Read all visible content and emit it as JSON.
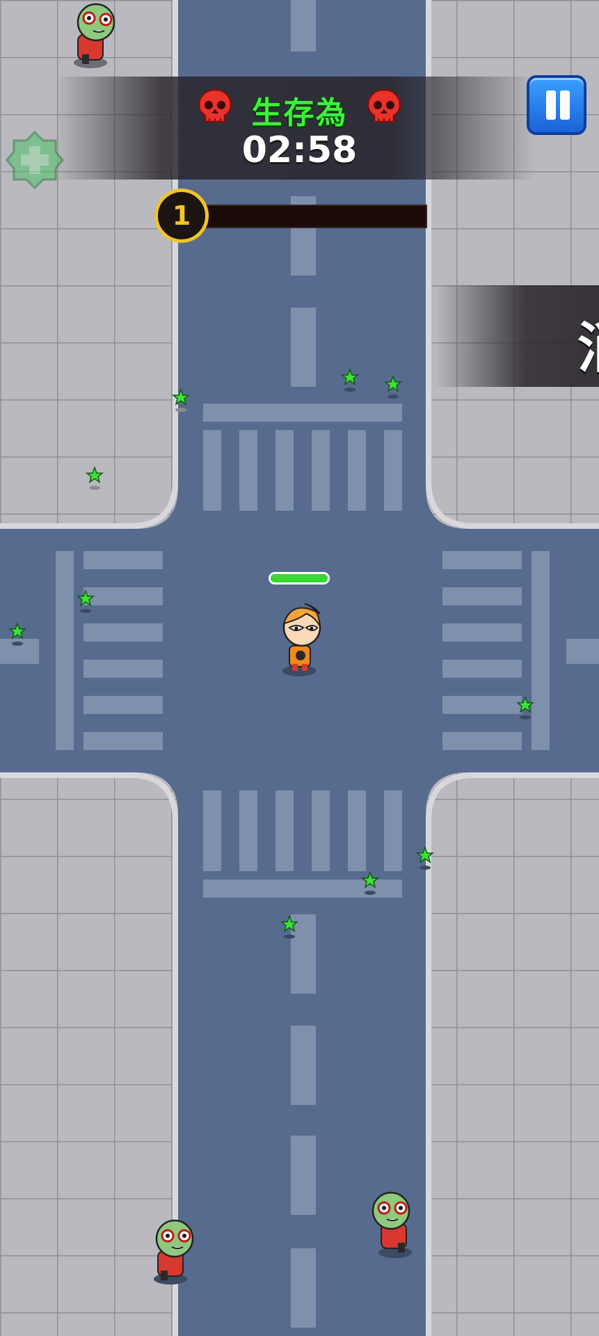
{
  "hud": {
    "mode_label": "生存為",
    "timer": "02:58",
    "level": "1",
    "level_progress": 0.0,
    "side_banner_text": "消"
  },
  "player": {
    "health": 1.0
  },
  "icons": {
    "skull": "skull-icon",
    "pause": "pause-icon",
    "heal": "heal-plus-icon",
    "star": "xp-star-icon"
  },
  "colors": {
    "title_green": "#3ef03c",
    "road": "#566b8e",
    "sidewalk": "#b9b9bf",
    "level_gold": "#f2c428",
    "health_green": "#39d834",
    "pause_blue": "#2a82ee",
    "skull_red": "#e8322a"
  }
}
